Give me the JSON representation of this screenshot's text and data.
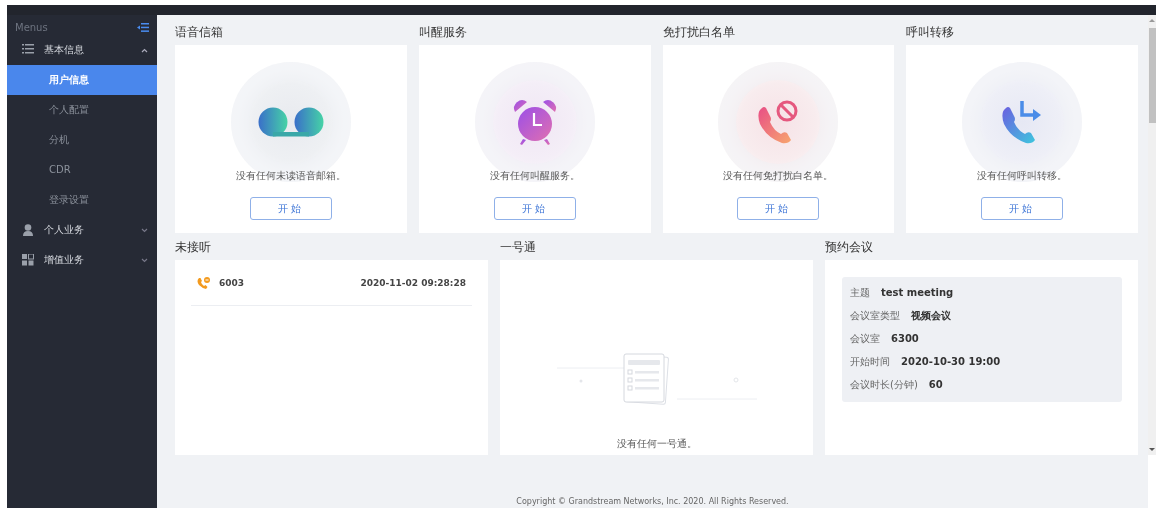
{
  "sidebar": {
    "header": "Menus",
    "items": [
      {
        "label": "基本信息",
        "kind": "list",
        "expanded": true,
        "children": [
          {
            "label": "用户信息",
            "selected": true
          },
          {
            "label": "个人配置",
            "selected": false
          },
          {
            "label": "分机",
            "selected": false
          },
          {
            "label": "CDR",
            "selected": false
          },
          {
            "label": "登录设置",
            "selected": false
          }
        ]
      },
      {
        "label": "个人业务",
        "kind": "person",
        "expanded": false
      },
      {
        "label": "增值业务",
        "kind": "grid",
        "expanded": false
      }
    ]
  },
  "feature_cards": [
    {
      "title": "语音信箱",
      "kind": "voicemail",
      "message": "没有任何未读语音邮箱。",
      "button": "开始"
    },
    {
      "title": "叫醒服务",
      "kind": "alarm",
      "message": "没有任何叫醒服务。",
      "button": "开始"
    },
    {
      "title": "免打扰白名单",
      "kind": "block",
      "message": "没有任何免打扰白名单。",
      "button": "开始"
    },
    {
      "title": "呼叫转移",
      "kind": "forward",
      "message": "没有任何呼叫转移。",
      "button": "开始"
    }
  ],
  "missed_calls": {
    "title": "未接听",
    "rows": [
      {
        "number": "6003",
        "time": "2020-11-02 09:28:28"
      }
    ]
  },
  "one_number": {
    "title": "一号通",
    "message": "没有任何一号通。"
  },
  "meeting": {
    "title": "预约会议",
    "fields": [
      {
        "label": "主题",
        "value": "test meeting"
      },
      {
        "label": "会议室类型",
        "value": "视频会议"
      },
      {
        "label": "会议室",
        "value": "6300"
      },
      {
        "label": "开始时间",
        "value": "2020-10-30 19:00"
      },
      {
        "label": "会议时长(分钟)",
        "value": "60"
      }
    ]
  },
  "footer": "Copyright © Grandstream Networks, Inc. 2020. All Rights Reserved."
}
